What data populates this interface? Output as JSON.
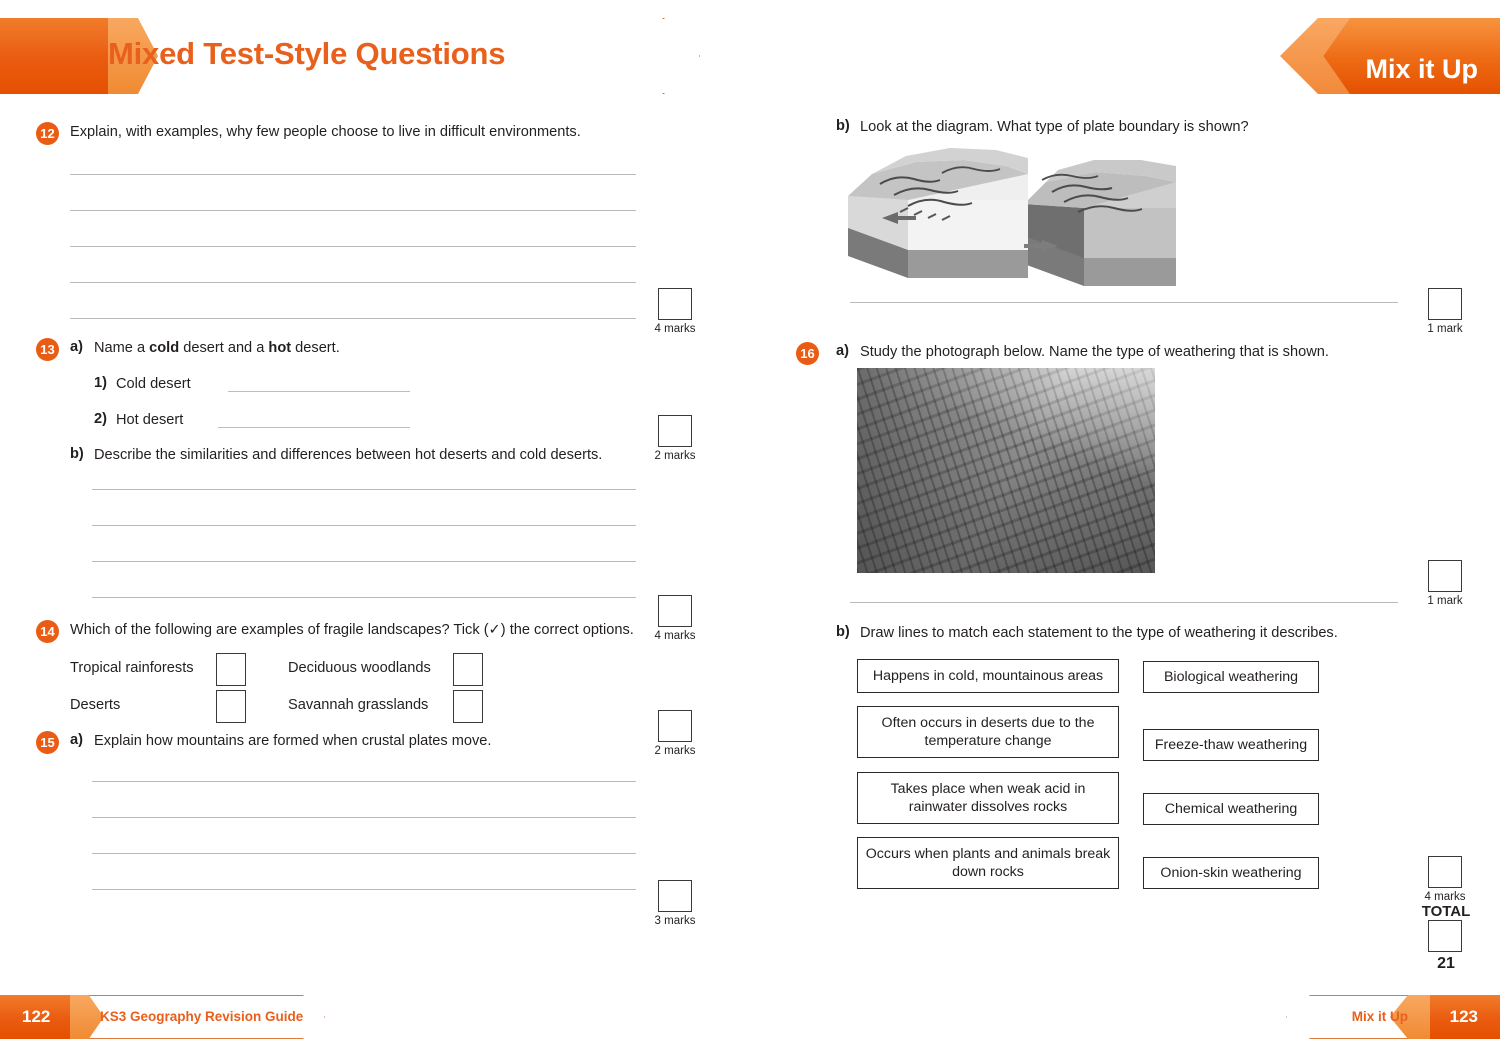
{
  "header": {
    "title": "Mixed Test-Style Questions",
    "tab_label": "Mix it Up"
  },
  "footer": {
    "left_page": "122",
    "left_text": "KS3 Geography Revision Guide",
    "right_text": "Mix it Up",
    "right_page": "123"
  },
  "left_column": {
    "q12": {
      "number": "12",
      "text": "Explain, with examples, why few people choose to live in difficult environments.",
      "marks": "4 marks",
      "line_count": 5
    },
    "q13": {
      "number": "13",
      "part_a_label": "a)",
      "part_a_text_1": "Name a ",
      "part_a_bold_1": "cold",
      "part_a_text_2": " desert and a ",
      "part_a_bold_2": "hot",
      "part_a_text_3": " desert.",
      "item_1_num": "1)",
      "item_1_label": "Cold desert",
      "item_2_num": "2)",
      "item_2_label": "Hot desert",
      "marks_a": "2 marks",
      "part_b_label": "b)",
      "part_b_text": "Describe the similarities and differences between hot deserts and cold deserts.",
      "marks_b": "4 marks",
      "line_count_b": 4
    },
    "q14": {
      "number": "14",
      "text": "Which of the following are examples of fragile landscapes? Tick (✓) the correct options.",
      "options": [
        "Tropical rainforests",
        "Deciduous woodlands",
        "Deserts",
        "Savannah grasslands"
      ],
      "marks": "2 marks"
    },
    "q15": {
      "number": "15",
      "part_a_label": "a)",
      "part_a_text": "Explain how mountains are formed when crustal plates move.",
      "marks_a": "3 marks",
      "line_count_a": 4
    }
  },
  "right_column": {
    "q15b": {
      "part_label": "b)",
      "text": "Look at the diagram. What type of plate boundary is shown?",
      "diagram_name": "plate-boundary-block-diagram",
      "marks": "1 mark"
    },
    "q16": {
      "number": "16",
      "part_a_label": "a)",
      "part_a_text": "Study the photograph below. Name the type of weathering that is shown.",
      "photo_name": "exposed-tree-roots-photograph",
      "marks_a": "1 mark",
      "part_b_label": "b)",
      "part_b_text": "Draw lines to match each statement to the type of weathering it describes.",
      "statements": [
        "Happens in cold, mountainous areas",
        "Often occurs in deserts due to the temperature change",
        "Takes place when weak acid in rainwater dissolves rocks",
        "Occurs when plants and animals break down rocks"
      ],
      "weathering_types": [
        "Biological weathering",
        "Freeze-thaw weathering",
        "Chemical weathering",
        "Onion-skin weathering"
      ],
      "marks_b": "4 marks"
    },
    "total": {
      "label": "TOTAL",
      "value": "21"
    }
  },
  "colors": {
    "brand_orange": "#e8601c",
    "deep_orange": "#e55000",
    "light_orange": "#f8a860",
    "rule_grey": "#b9b9b9",
    "ink": "#231f20"
  }
}
